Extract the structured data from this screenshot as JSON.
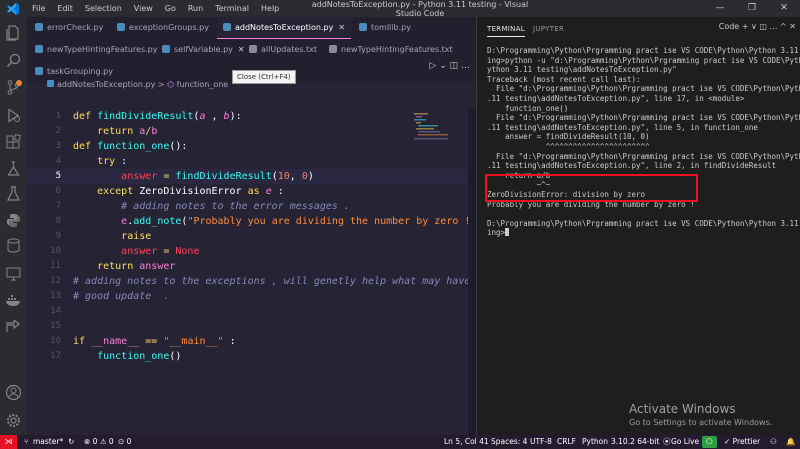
{
  "titlebar": {
    "menu": [
      "File",
      "Edit",
      "Selection",
      "View",
      "Go",
      "Run",
      "Terminal",
      "Help"
    ],
    "window_title": "addNotesToException.py - Python 3.11 testing - Visual Studio Code",
    "controls": [
      "—",
      "❐",
      "✕"
    ]
  },
  "activity_icons": [
    "files-icon",
    "search-icon",
    "source-control-icon",
    "run-debug-icon",
    "extensions-icon",
    "testing-icon",
    "flask-icon",
    "python-icon",
    "database-icon",
    "remote-explorer-icon",
    "docker-icon",
    "live-share-icon",
    "account-icon",
    "settings-gear-icon"
  ],
  "tabs_row1": [
    {
      "label": "errorCheck.py",
      "type": "py"
    },
    {
      "label": "exceptionGroups.py",
      "type": "py"
    },
    {
      "label": "addNotesToException.py",
      "type": "py",
      "active": true
    },
    {
      "label": "tomllib.py",
      "type": "py"
    }
  ],
  "tabs_row2": [
    {
      "label": "newTypeHintingFeatures.py",
      "type": "py"
    },
    {
      "label": "selfVariable.py",
      "type": "py"
    },
    {
      "label": "allUpdates.txt",
      "type": "txt"
    },
    {
      "label": "newTypeHintingFeatures.txt",
      "type": "txt"
    }
  ],
  "tabs_row3": [
    {
      "label": "taskGrouping.py",
      "type": "py"
    }
  ],
  "tooltip": "Close (Ctrl+F4)",
  "breadcrumb": {
    "file": "addNotesToException.py",
    "separator": ">",
    "symbol": "function_one"
  },
  "editor": {
    "current_line": 5,
    "line_numbers": [
      "1",
      "2",
      "3",
      "4",
      "5",
      "6",
      "7",
      "8",
      "9",
      "10",
      "11",
      "12",
      "13",
      "14",
      "15",
      "16",
      "17"
    ]
  },
  "terminal": {
    "tabs": [
      "TERMINAL",
      "JUPYTER"
    ],
    "actions": "Code  +  ∨  ◫  …  ^  ✕",
    "lines": [
      "D:\\Programming\\Python\\Prgramming pract ise VS CODE\\Python\\Python 3.11 teste",
      "ing>python -u \"d:\\Programming\\Python\\Prgramming pract ise VS CODE\\Python\\P",
      "ython 3.11 testing\\addNotesToException.py\"",
      "Traceback (most recent call last):",
      "  File \"d:\\Programming\\Python\\Prgramming pract ise VS CODE\\Python\\Python 3",
      ".11 testing\\addNotesToException.py\", line 17, in <module>",
      "    function_one()",
      "  File \"d:\\Programming\\Python\\Prgramming pract ise VS CODE\\Python\\Python 3",
      ".11 testing\\addNotesToException.py\", line 5, in function_one",
      "    answer = findDivideResult(10, 0)",
      "             ^^^^^^^^^^^^^^^^^^^^^^^",
      "  File \"d:\\Programming\\Python\\Prgramming pract ise VS CODE\\Python\\Python 3",
      ".11 testing\\addNotesToException.py\", line 2, in findDivideResult",
      "    return a/b",
      "           ~^~",
      "ZeroDivisionError: division by zero",
      "Probably you are dividing the number by zero !",
      "",
      "D:\\Programming\\Python\\Prgramming pract ise VS CODE\\Python\\Python 3.11 test",
      "ing>"
    ]
  },
  "watermark": {
    "title": "Activate Windows",
    "subtitle": "Go to Settings to activate Windows."
  },
  "statusbar": {
    "branch": "master*",
    "sync": "↻",
    "problems": "⊗ 0 ⚠ 0",
    "ports": "⊙ 0",
    "position": "Ln 5, Col 41",
    "spaces": "Spaces: 4",
    "encoding": "UTF-8",
    "eol": "CRLF",
    "language": "Python",
    "interpreter": "3.10.2 64-bit",
    "golive": "Go Live",
    "prettier": "✓ Prettier",
    "accent_color": "#e81123"
  }
}
